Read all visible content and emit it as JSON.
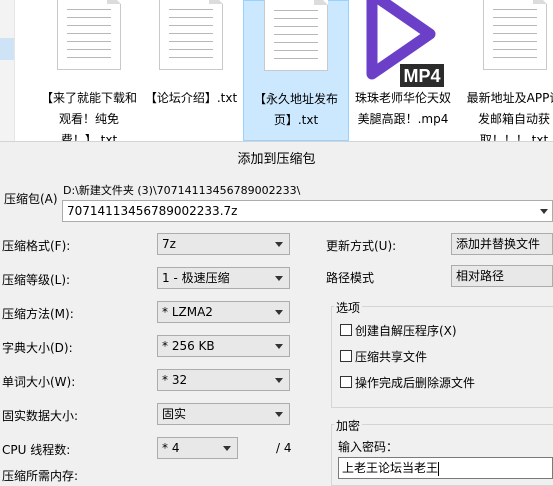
{
  "files": [
    {
      "name": "【来了就能下载和观看！纯免费！】.txt"
    },
    {
      "name": "【论坛介绍】.txt"
    },
    {
      "name": "【永久地址发布页】.txt"
    },
    {
      "name": "珠珠老师华伦天奴美腿高跟！.mp4",
      "badge": "MP4"
    },
    {
      "name": "最新地址及APP请发邮箱自动获取！！！.txt"
    }
  ],
  "dialog": {
    "title": "添加到压缩包",
    "archive_label": "压缩包(A)",
    "archive_path": "D:\\新建文件夹 (3)\\70714113456789002233\\",
    "archive_name": "70714113456789002233.7z",
    "format": {
      "label": "压缩格式(F):",
      "value": "7z"
    },
    "level": {
      "label": "压缩等级(L):",
      "value": "1 - 极速压缩"
    },
    "method": {
      "label": "压缩方法(M):",
      "value": "* LZMA2"
    },
    "dict": {
      "label": "字典大小(D):",
      "value": "* 256 KB"
    },
    "word": {
      "label": "单词大小(W):",
      "value": "* 32"
    },
    "solid": {
      "label": "固实数据大小:",
      "value": "固实"
    },
    "cpu": {
      "label": "CPU 线程数:",
      "value": "* 4",
      "total": "/ 4"
    },
    "memory_label": "压缩所需内存:",
    "update": {
      "label": "更新方式(U):",
      "value": "添加并替换文件"
    },
    "pathmode": {
      "label": "路径模式",
      "value": "相对路径"
    },
    "options": {
      "title": "选项",
      "sfx": "创建自解压程序(X)",
      "shared": "压缩共享文件",
      "delete": "操作完成后删除源文件"
    },
    "encryption": {
      "title": "加密",
      "password_label": "输入密码：",
      "password_value": "上老王论坛当老王"
    }
  },
  "colors": {
    "selection": "#cce8ff",
    "selection_border": "#99d1ff",
    "mp4_purple": "#6b3fc7",
    "dialog_bg": "#f0f0f0"
  }
}
